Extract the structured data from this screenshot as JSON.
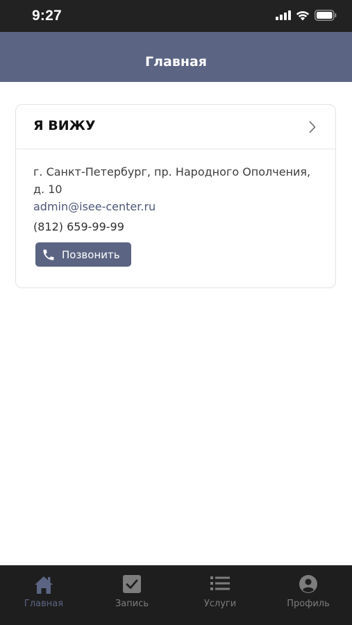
{
  "status_bar": {
    "time": "9:27"
  },
  "nav": {
    "title": "Главная"
  },
  "card": {
    "title": "Я ВИЖУ",
    "address": "г. Санкт-Петербург, пр. Народного Ополчения, д. 10",
    "email": "admin@isee-center.ru",
    "phone": "(812) 659-99-99",
    "call_button_label": "Позвонить"
  },
  "tabs": [
    {
      "label": "Главная",
      "icon": "home-icon",
      "active": true
    },
    {
      "label": "Запись",
      "icon": "checkbox-icon",
      "active": false
    },
    {
      "label": "Услуги",
      "icon": "list-icon",
      "active": false
    },
    {
      "label": "Профиль",
      "icon": "profile-icon",
      "active": false
    }
  ],
  "colors": {
    "accent": "#5b6583",
    "status_bar": "#222222",
    "tab_bar": "#1e1e1e"
  }
}
